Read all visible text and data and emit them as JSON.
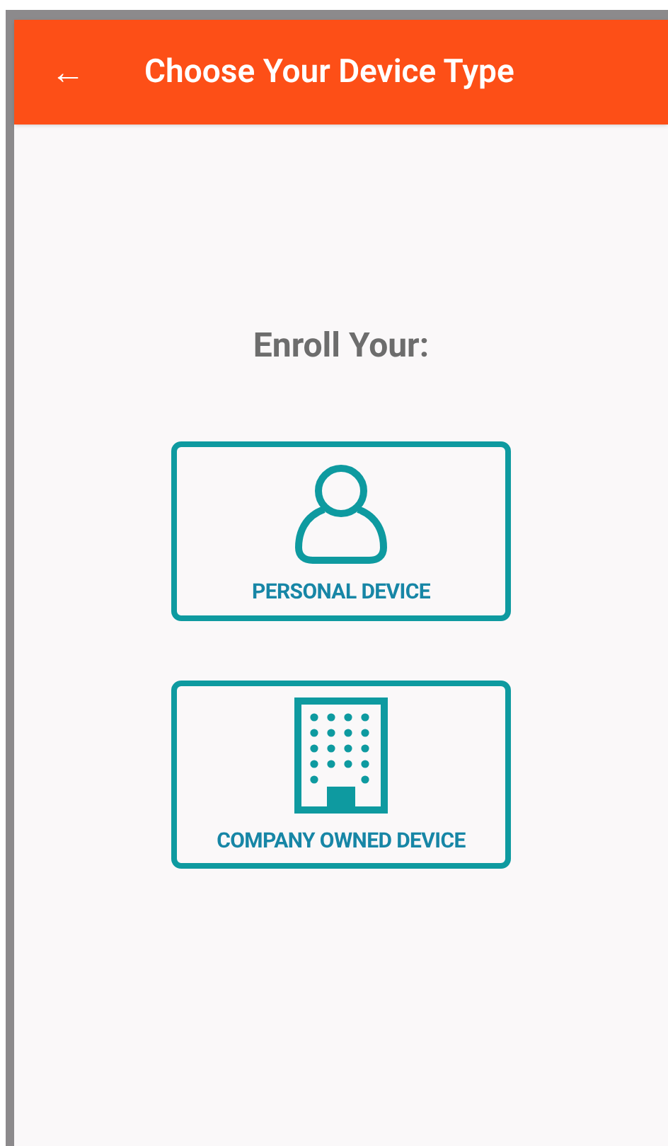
{
  "app_bar": {
    "back_icon": "←",
    "title": "Choose Your Device Type"
  },
  "prompt": "Enroll Your:",
  "options": [
    {
      "kind": "person",
      "label": "PERSONAL DEVICE"
    },
    {
      "kind": "building",
      "label": "COMPANY OWNED DEVICE"
    }
  ]
}
